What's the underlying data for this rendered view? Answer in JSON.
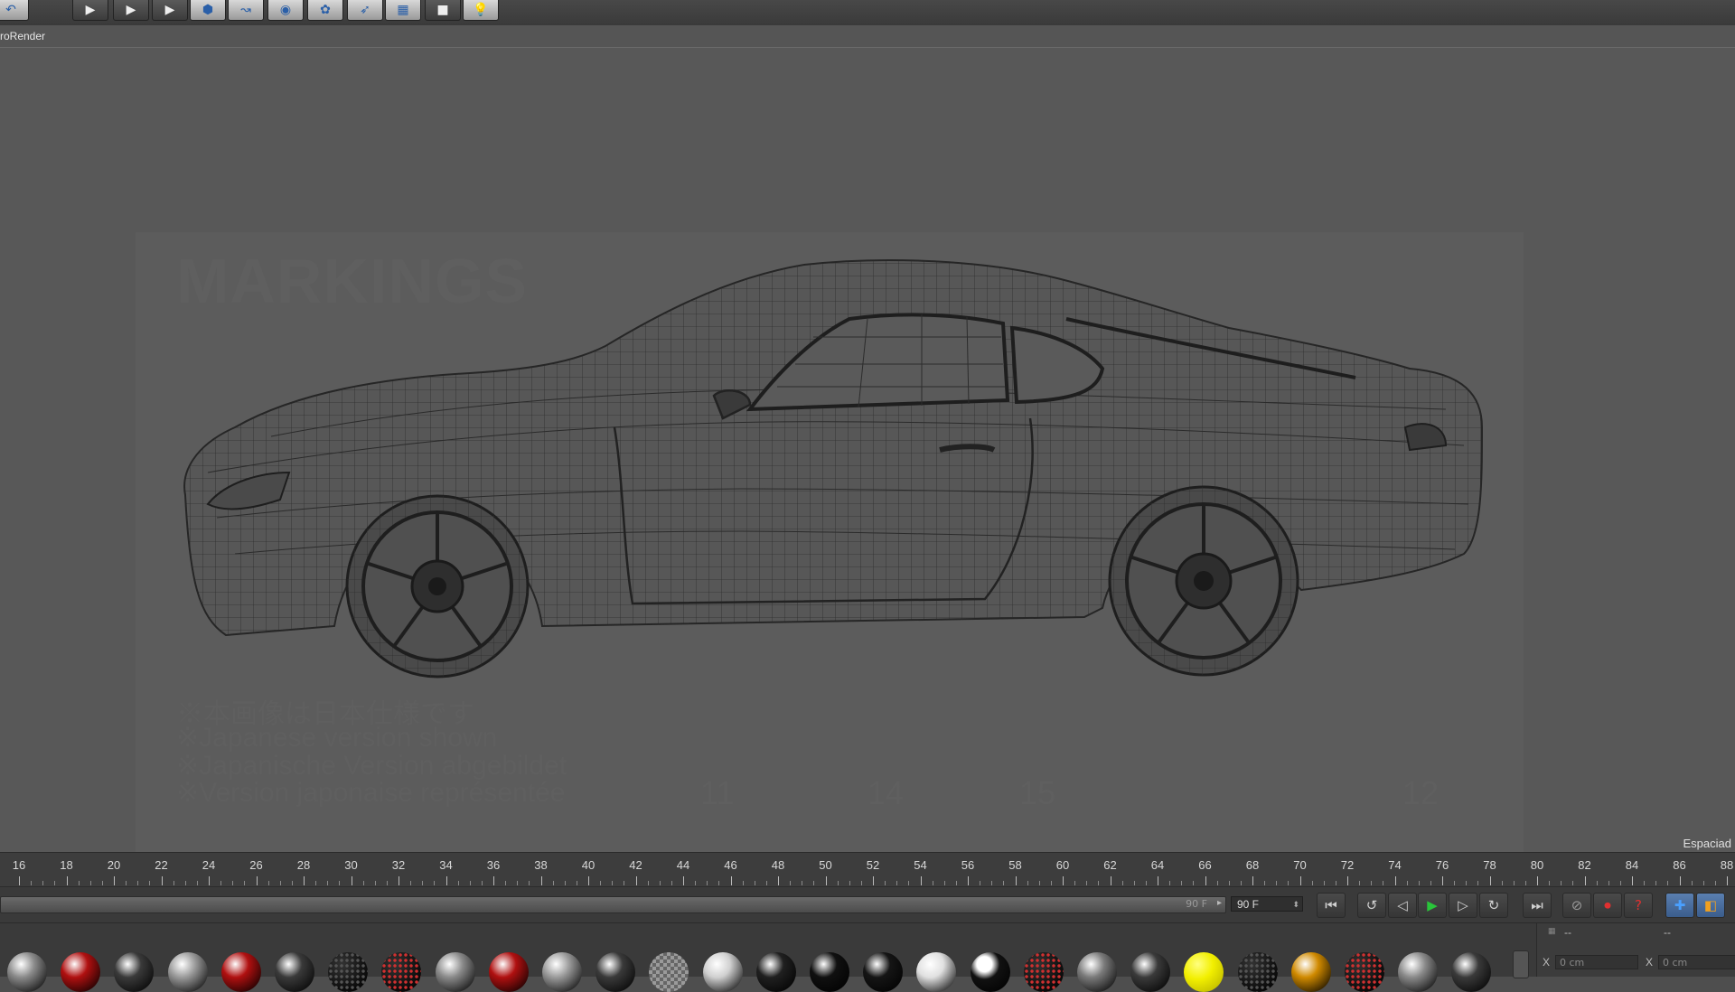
{
  "toolbar": {
    "buttons": [
      {
        "name": "undo-icon"
      },
      {
        "name": "render-view-icon"
      },
      {
        "name": "render-picture-viewer-icon"
      },
      {
        "name": "render-settings-icon"
      },
      {
        "name": "cube-icon"
      },
      {
        "name": "spline-icon"
      },
      {
        "name": "nurbs-icon"
      },
      {
        "name": "array-icon"
      },
      {
        "name": "deformer-icon"
      },
      {
        "name": "floor-icon"
      },
      {
        "name": "camera-icon"
      },
      {
        "name": "light-icon"
      }
    ]
  },
  "viewport": {
    "title": "roRender",
    "corner_label": "Espaciad",
    "reference": {
      "heading": "MARKINGS",
      "notes": [
        "※本画像は日本仕様です",
        "※Japanese version shown",
        "※Japanische Version abgebildet",
        "※Version japonaise représentée"
      ],
      "numbers": [
        "11",
        "14",
        "15",
        "12"
      ]
    }
  },
  "timeline": {
    "labels": [
      "16",
      "18",
      "20",
      "22",
      "24",
      "26",
      "28",
      "30",
      "32",
      "34",
      "36",
      "38",
      "40",
      "42",
      "44",
      "46",
      "48",
      "50",
      "52",
      "54",
      "56",
      "58",
      "60",
      "62",
      "64",
      "66",
      "68",
      "70",
      "72",
      "74",
      "76",
      "78",
      "80",
      "82",
      "84",
      "86",
      "88"
    ]
  },
  "transport": {
    "range_label": "90 F",
    "frame_field": "90 F",
    "buttons": [
      {
        "name": "go-to-start-icon",
        "glyph": "⏮"
      },
      {
        "name": "go-to-previous-key-icon",
        "glyph": "↺"
      },
      {
        "name": "step-back-icon",
        "glyph": "◁"
      },
      {
        "name": "play-icon",
        "glyph": "▶"
      },
      {
        "name": "step-forward-icon",
        "glyph": "▷"
      },
      {
        "name": "go-to-next-key-icon",
        "glyph": "↻"
      },
      {
        "name": "go-to-end-icon",
        "glyph": "⏭"
      },
      {
        "name": "keyframe-selection-icon",
        "glyph": "⊘"
      },
      {
        "name": "record-active-objects-icon",
        "glyph": "⏺"
      },
      {
        "name": "autokeying-icon",
        "glyph": "?"
      },
      {
        "name": "move-tool-icon",
        "glyph": "✚"
      },
      {
        "name": "scale-tool-icon",
        "glyph": "◧"
      }
    ]
  },
  "materials": {
    "items": [
      {
        "color": "#8a8a8a",
        "type": "grey"
      },
      {
        "color": "#b01010",
        "type": "red"
      },
      {
        "color": "#3a3a3a",
        "type": "dark"
      },
      {
        "color": "#9a9a9a",
        "type": "grey"
      },
      {
        "color": "#b01010",
        "type": "red"
      },
      {
        "color": "#3a3a3a",
        "type": "dark"
      },
      {
        "color": "#1a1a1a",
        "type": "dotted"
      },
      {
        "color": "#5a1010",
        "type": "dotted-red"
      },
      {
        "color": "#8a8a8a",
        "type": "grey"
      },
      {
        "color": "#b01010",
        "type": "red"
      },
      {
        "color": "#9a9a9a",
        "type": "grey"
      },
      {
        "color": "#3a3a3a",
        "type": "dark"
      },
      {
        "color": "#7a7a7a",
        "type": "checker"
      },
      {
        "color": "#d0d0d0",
        "type": "white"
      },
      {
        "color": "#202020",
        "type": "black"
      },
      {
        "color": "#101010",
        "type": "black"
      },
      {
        "color": "#151515",
        "type": "black"
      },
      {
        "color": "#e0e0e0",
        "type": "white"
      },
      {
        "color": "#111111",
        "type": "black-white"
      },
      {
        "color": "#5a1010",
        "type": "dotted-red"
      },
      {
        "color": "#7a7a7a",
        "type": "grey"
      },
      {
        "color": "#3a3a3a",
        "type": "dark"
      },
      {
        "color": "#f2ef00",
        "type": "yellow"
      },
      {
        "color": "#1a1a1a",
        "type": "dotted"
      },
      {
        "color": "#d08a00",
        "type": "orange"
      },
      {
        "color": "#5a1010",
        "type": "dotted-red"
      },
      {
        "color": "#8a8a8a",
        "type": "grey"
      },
      {
        "color": "#3a3a3a",
        "type": "dark"
      }
    ]
  },
  "coords": {
    "axis_x": "X",
    "axis_x2": "X",
    "value_x": "0 cm",
    "value_x2": "0 cm",
    "header_dash": "--",
    "header_dash2": "--"
  }
}
